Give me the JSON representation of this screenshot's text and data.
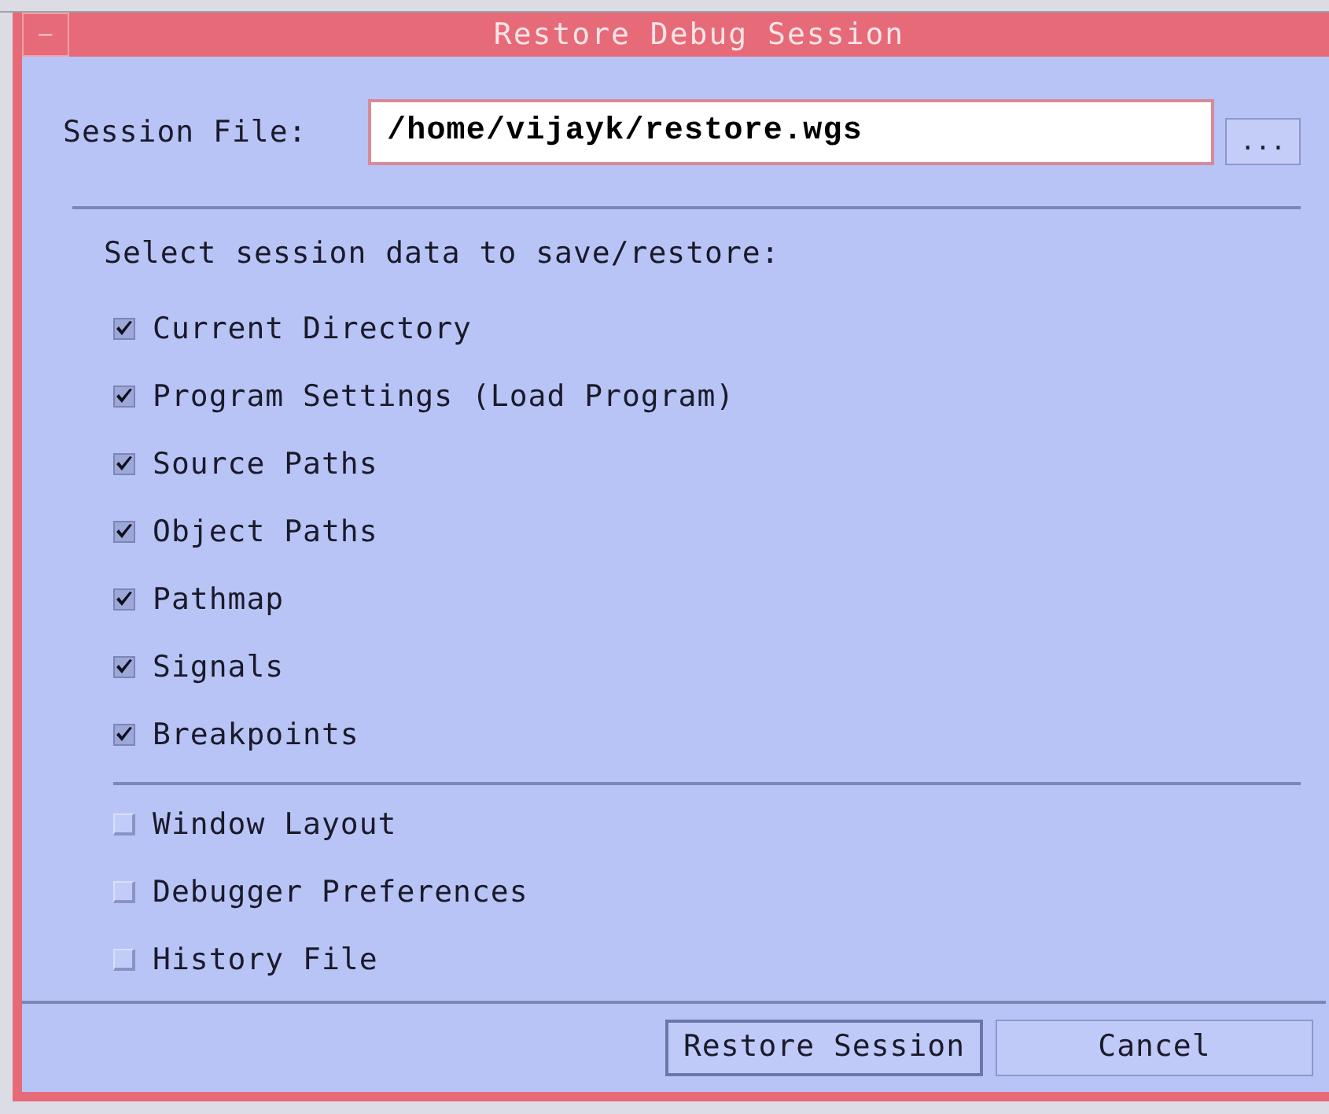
{
  "window": {
    "title": "Restore Debug Session",
    "menu_glyph": "–"
  },
  "session_file": {
    "label": "Session File:",
    "value": "/home/vijayk/restore.wgs",
    "browse": "..."
  },
  "prompt": "Select session data to save/restore:",
  "groups": [
    {
      "items": [
        {
          "label": "Current Directory",
          "checked": true
        },
        {
          "label": "Program Settings (Load Program)",
          "checked": true
        },
        {
          "label": "Source Paths",
          "checked": true
        },
        {
          "label": "Object Paths",
          "checked": true
        },
        {
          "label": "Pathmap",
          "checked": true
        },
        {
          "label": "Signals",
          "checked": true
        },
        {
          "label": "Breakpoints",
          "checked": true
        }
      ]
    },
    {
      "items": [
        {
          "label": "Window Layout",
          "checked": false
        },
        {
          "label": "Debugger Preferences",
          "checked": false
        },
        {
          "label": "History File",
          "checked": false
        }
      ]
    }
  ],
  "buttons": [
    {
      "label": "Restore Session",
      "kind": "default"
    },
    {
      "label": "Cancel",
      "kind": "normal"
    }
  ]
}
